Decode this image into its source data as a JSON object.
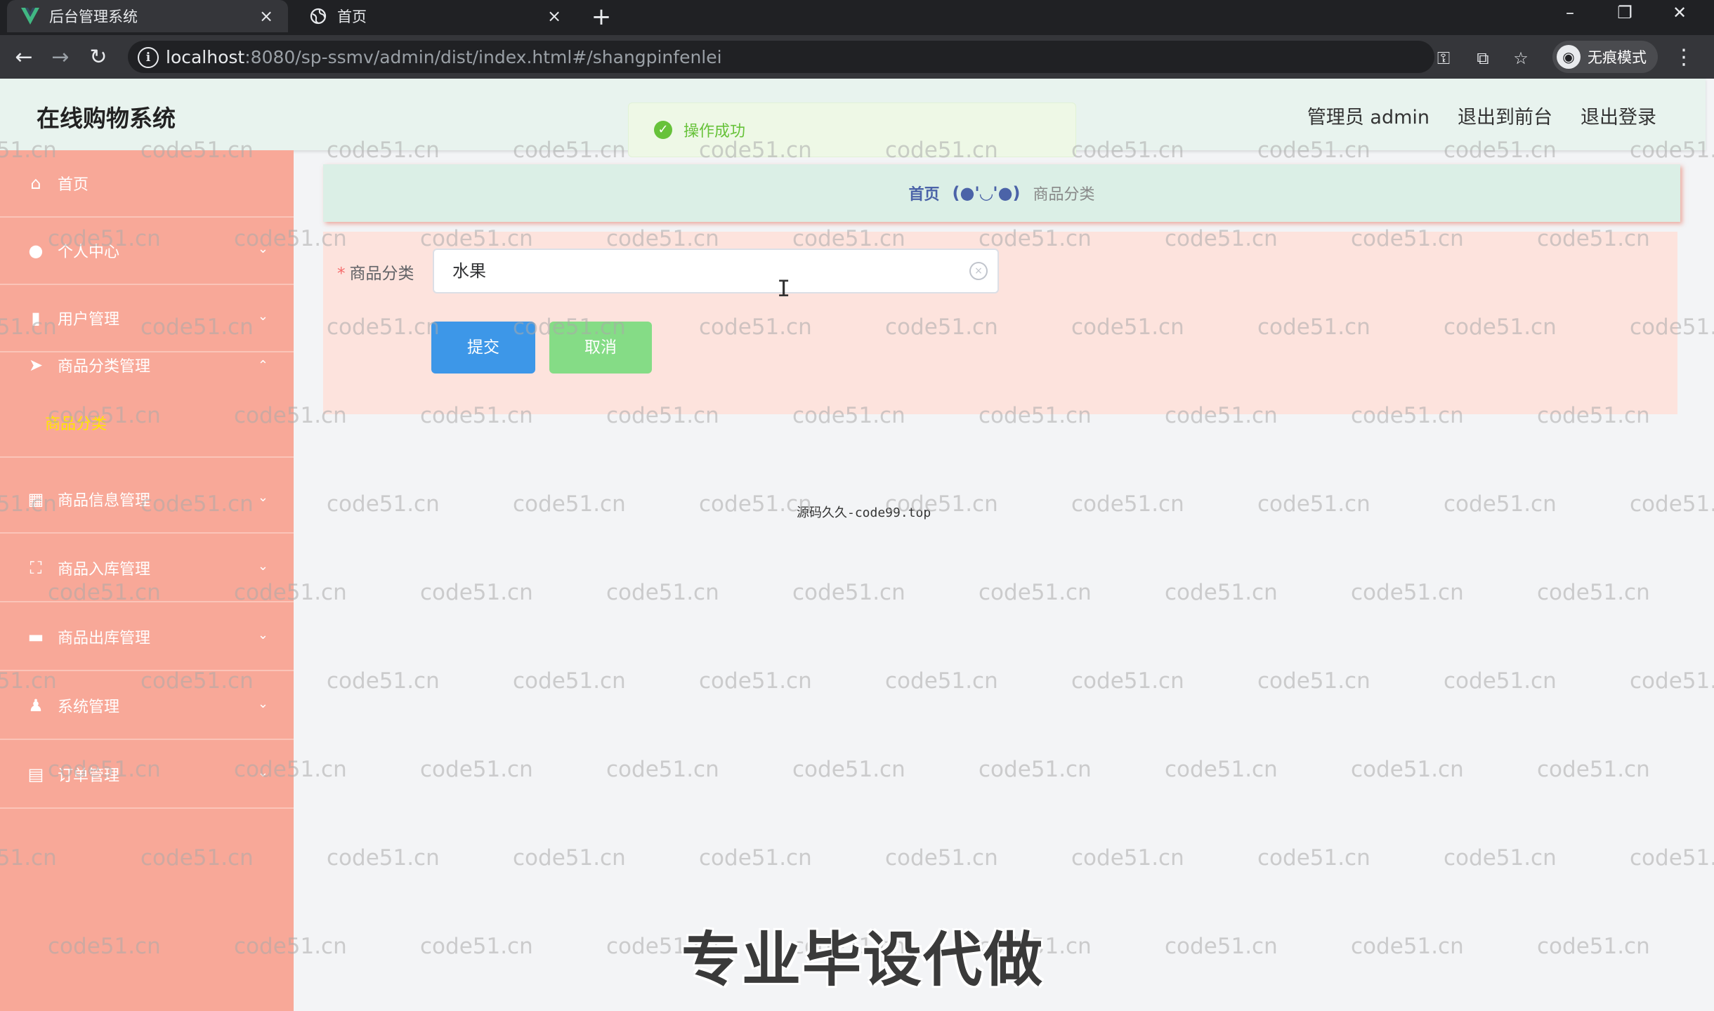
{
  "browser": {
    "tabs": [
      {
        "title": "后台管理系统",
        "icon": "vue-logo-icon",
        "active": true
      },
      {
        "title": "首页",
        "icon": "globe-icon",
        "active": false
      }
    ],
    "url_host": "localhost",
    "url_rest": ":8080/sp-ssmv/admin/dist/index.html#/shangpinfenlei",
    "incognito_label": "无痕模式"
  },
  "header": {
    "title": "在线购物系统",
    "admin_label": "管理员 admin",
    "to_front_label": "退出到前台",
    "logout_label": "退出登录"
  },
  "toast": {
    "message": "操作成功",
    "color": "#67c23a"
  },
  "sidebar": {
    "items": [
      {
        "label": "首页",
        "icon": "home-icon"
      },
      {
        "label": "个人中心",
        "icon": "user-icon"
      },
      {
        "label": "用户管理",
        "icon": "chart-icon"
      },
      {
        "label": "商品分类管理",
        "icon": "send-icon"
      },
      {
        "label": "商品信息管理",
        "icon": "trend-icon"
      },
      {
        "label": "商品入库管理",
        "icon": "scan-icon"
      },
      {
        "label": "商品出库管理",
        "icon": "briefcase-icon"
      },
      {
        "label": "系统管理",
        "icon": "person-icon"
      },
      {
        "label": "订单管理",
        "icon": "clipboard-icon"
      }
    ],
    "sub_item_active": "商品分类",
    "active_color": "#ffe600",
    "background": "#f8a898"
  },
  "breadcrumb": {
    "home": "首页",
    "separator": "(●'◡'●)",
    "current": "商品分类"
  },
  "form": {
    "category_label": "商品分类",
    "category_value": "水果",
    "submit_label": "提交",
    "cancel_label": "取消"
  },
  "center_note": "源码久久-code99.top",
  "overlay": {
    "watermark_text": "code51.cn",
    "promo_text": "专业毕设代做"
  }
}
